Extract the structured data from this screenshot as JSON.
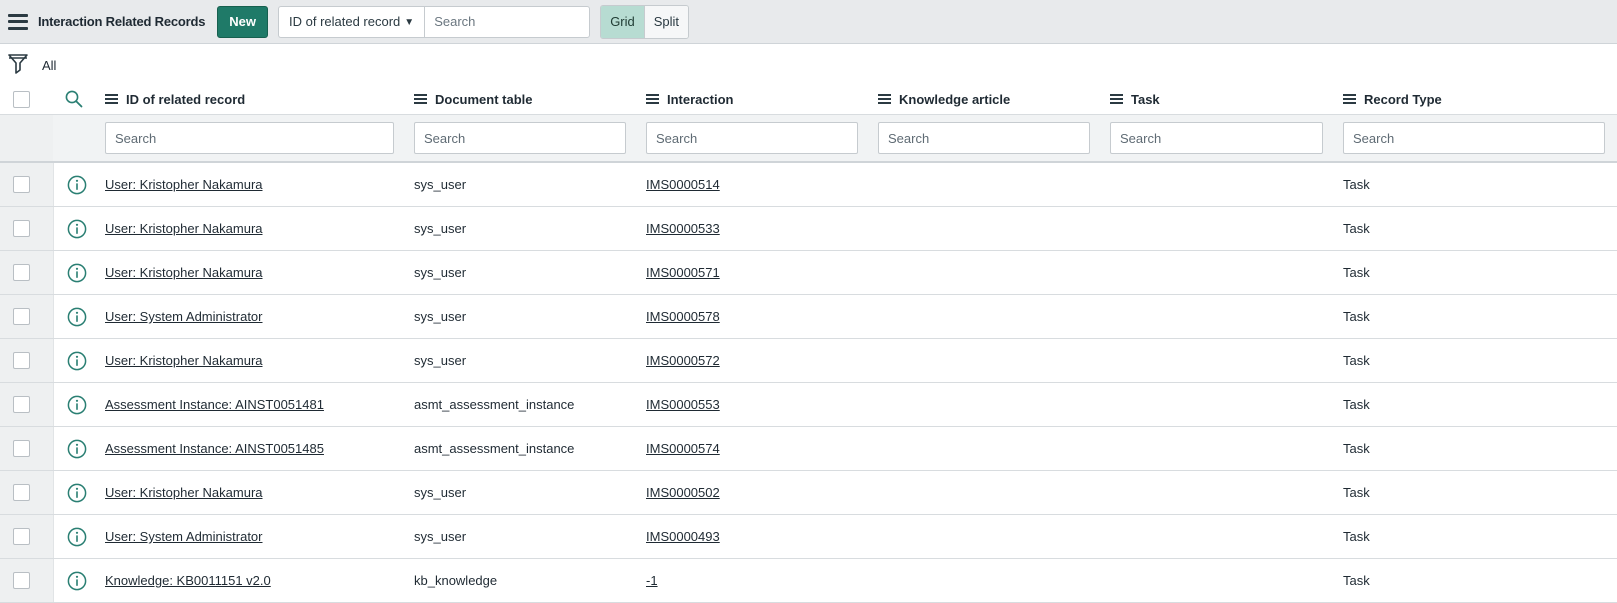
{
  "header": {
    "title": "Interaction Related Records",
    "new_label": "New",
    "search_field": "ID of related record",
    "search_placeholder": "Search",
    "view_grid": "Grid",
    "view_split": "Split"
  },
  "filter": {
    "label": "All"
  },
  "columns": [
    {
      "label": "ID of related record",
      "search_placeholder": "Search"
    },
    {
      "label": "Document table",
      "search_placeholder": "Search"
    },
    {
      "label": "Interaction",
      "search_placeholder": "Search"
    },
    {
      "label": "Knowledge article",
      "search_placeholder": "Search"
    },
    {
      "label": "Task",
      "search_placeholder": "Search"
    },
    {
      "label": "Record Type",
      "search_placeholder": "Search"
    }
  ],
  "rows": [
    {
      "id_related": "User: Kristopher Nakamura",
      "document_table": "sys_user",
      "interaction": "IMS0000514",
      "knowledge_article": "",
      "task": "",
      "record_type": "Task"
    },
    {
      "id_related": "User: Kristopher Nakamura",
      "document_table": "sys_user",
      "interaction": "IMS0000533",
      "knowledge_article": "",
      "task": "",
      "record_type": "Task"
    },
    {
      "id_related": "User: Kristopher Nakamura",
      "document_table": "sys_user",
      "interaction": "IMS0000571",
      "knowledge_article": "",
      "task": "",
      "record_type": "Task"
    },
    {
      "id_related": "User: System Administrator",
      "document_table": "sys_user",
      "interaction": "IMS0000578",
      "knowledge_article": "",
      "task": "",
      "record_type": "Task"
    },
    {
      "id_related": "User: Kristopher Nakamura",
      "document_table": "sys_user",
      "interaction": "IMS0000572",
      "knowledge_article": "",
      "task": "",
      "record_type": "Task"
    },
    {
      "id_related": "Assessment Instance: AINST0051481",
      "document_table": "asmt_assessment_instance",
      "interaction": "IMS0000553",
      "knowledge_article": "",
      "task": "",
      "record_type": "Task"
    },
    {
      "id_related": "Assessment Instance: AINST0051485",
      "document_table": "asmt_assessment_instance",
      "interaction": "IMS0000574",
      "knowledge_article": "",
      "task": "",
      "record_type": "Task"
    },
    {
      "id_related": "User: Kristopher Nakamura",
      "document_table": "sys_user",
      "interaction": "IMS0000502",
      "knowledge_article": "",
      "task": "",
      "record_type": "Task"
    },
    {
      "id_related": "User: System Administrator",
      "document_table": "sys_user",
      "interaction": "IMS0000493",
      "knowledge_article": "",
      "task": "",
      "record_type": "Task"
    },
    {
      "id_related": "Knowledge: KB0011151 v2.0",
      "document_table": "kb_knowledge",
      "interaction": "-1",
      "knowledge_article": "",
      "task": "",
      "record_type": "Task"
    }
  ],
  "colors": {
    "accent": "#1f7a68",
    "toggle_active": "#b7dcd2",
    "icon": "#2a7f73"
  },
  "icons": [
    "menu-icon",
    "filter-icon",
    "search-icon",
    "info-icon",
    "caret-down-icon"
  ]
}
